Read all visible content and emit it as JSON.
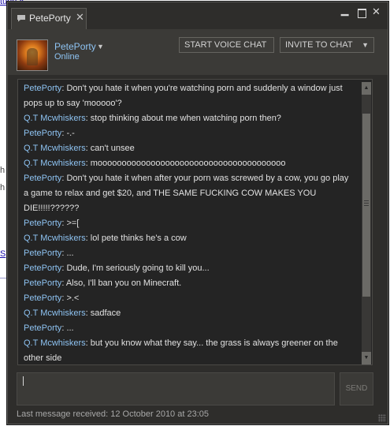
{
  "background": {
    "link_top": "tune »",
    "letter_h1": "h",
    "letter_h2": "h",
    "link_s": "S"
  },
  "window": {
    "tab_label": "PetePorty",
    "tab_close": "✕",
    "minimize": "▁",
    "close": "✕"
  },
  "header": {
    "user_name": "PetePorty",
    "user_status": "Online",
    "start_voice_chat": "START VOICE CHAT",
    "invite_to_chat": "INVITE TO CHAT"
  },
  "messages": [
    {
      "sender": "PetePorty",
      "text": "Don't you hate it when you're watching porn and suddenly a window just pops up to say 'mooooo'?"
    },
    {
      "sender": "Q.T Mcwhiskers",
      "text": "stop thinking about me when watching porn then?"
    },
    {
      "sender": "PetePorty",
      "text": "-.-"
    },
    {
      "sender": "Q.T Mcwhiskers",
      "text": "can't unsee"
    },
    {
      "sender": "Q.T Mcwhiskers",
      "text": "mooooooooooooooooooooooooooooooooooooooo"
    },
    {
      "sender": "PetePorty",
      "text": "Don't you hate it when after your porn was screwed by a cow, you go play a game to relax and get $20, and THE SAME FUCKING COW MAKES YOU DIE!!!!!??????"
    },
    {
      "sender": "PetePorty",
      "text": ">=["
    },
    {
      "sender": "Q.T Mcwhiskers",
      "text": "lol pete thinks he's a cow"
    },
    {
      "sender": "PetePorty",
      "text": "..."
    },
    {
      "sender": "PetePorty",
      "text": "Dude, I'm seriously going to kill you..."
    },
    {
      "sender": "PetePorty",
      "text": "Also, I'll ban you on Minecraft."
    },
    {
      "sender": "PetePorty",
      "text": ">.<"
    },
    {
      "sender": "Q.T Mcwhiskers",
      "text": "sadface"
    },
    {
      "sender": "PetePorty",
      "text": "..."
    },
    {
      "sender": "Q.T Mcwhiskers",
      "text": "but you know what they say... the grass is always greener on the other side"
    }
  ],
  "composer": {
    "send_label": "SEND"
  },
  "footer": {
    "last_message": "Last message received: 12 October 2010 at 23:05"
  },
  "colors": {
    "window_bg": "#2e2d2b",
    "log_bg": "#242424",
    "sender_name": "#8ec3f2",
    "message_text": "#e1e1e1"
  }
}
